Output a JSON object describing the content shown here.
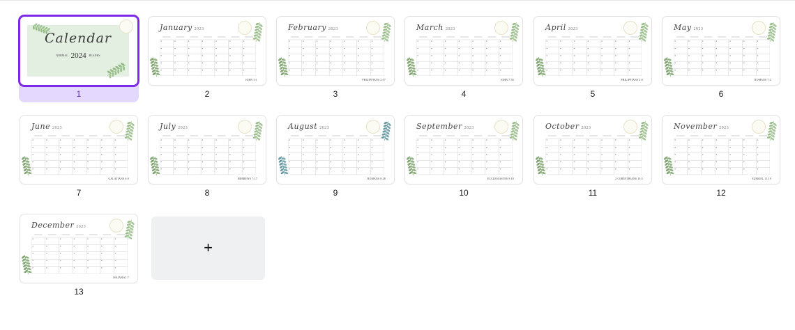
{
  "pages": [
    {
      "number": "1",
      "type": "cover",
      "title": "Calendar",
      "year": "2024",
      "left_text": "NORMAL",
      "right_text": "BLANKS",
      "selected": true
    },
    {
      "number": "2",
      "month": "January",
      "year": "2023",
      "verse": "JOHN 3:1"
    },
    {
      "number": "3",
      "month": "February",
      "year": "2023",
      "verse": "PHILIPPIANS 2:37"
    },
    {
      "number": "4",
      "month": "March",
      "year": "2023",
      "verse": "JOHN 7:36"
    },
    {
      "number": "5",
      "month": "April",
      "year": "2023",
      "verse": "PHILIPPIANS 4:8"
    },
    {
      "number": "6",
      "month": "May",
      "year": "2023",
      "verse": "ROMANS 7:5"
    },
    {
      "number": "7",
      "month": "June",
      "year": "2023",
      "verse": "GALATIANS 6:9"
    },
    {
      "number": "8",
      "month": "July",
      "year": "2023",
      "verse": "HEBREWS 7:17"
    },
    {
      "number": "9",
      "month": "August",
      "year": "2023",
      "verse": "ROMANS 8:28"
    },
    {
      "number": "10",
      "month": "September",
      "year": "2023",
      "verse": "ECCLESIASTES 9:18"
    },
    {
      "number": "11",
      "month": "October",
      "year": "2023",
      "verse": "2 CORINTHIANS 10:5"
    },
    {
      "number": "12",
      "month": "November",
      "year": "2023",
      "verse": "EZEKIEL 11:19"
    },
    {
      "number": "13",
      "month": "December",
      "year": "2023",
      "verse": "ISAIAH 61:7"
    }
  ],
  "add_page": {
    "label": "+",
    "icon": "plus-icon"
  },
  "colors": {
    "selected_border": "#7d2ae8",
    "selected_bg": "#e4d8ff",
    "leaf": "#7fae6c",
    "leaf_dark": "#5f8f4c",
    "leaf_blue": "#3f7f8c"
  }
}
